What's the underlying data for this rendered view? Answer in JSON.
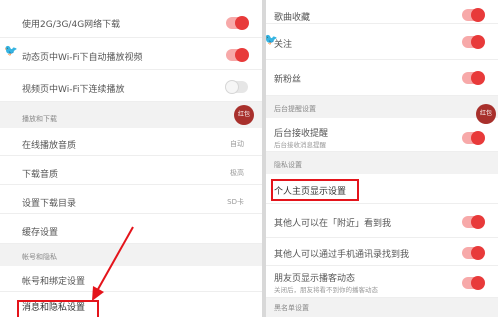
{
  "left_panel": {
    "rows": [
      {
        "label": "使用2G/3G/4G网络下载",
        "toggle": "on"
      },
      {
        "label": "动态页中Wi-Fi下自动播放视频",
        "toggle": "on"
      },
      {
        "label": "视频页中Wi-Fi下连续播放",
        "toggle": "off"
      }
    ],
    "section_playback": "播放和下载",
    "badge_text": "红包",
    "playback_rows": [
      {
        "label": "在线播放音质",
        "value": "自动"
      },
      {
        "label": "下载音质",
        "value": "极高"
      },
      {
        "label": "设置下载目录",
        "value": "SD卡"
      },
      {
        "label": "缓存设置",
        "value": ""
      }
    ],
    "section_account": "帐号和隐私",
    "account_rows": [
      {
        "label": "帐号和绑定设置"
      },
      {
        "label": "消息和隐私设置"
      }
    ]
  },
  "right_panel": {
    "rows_top": [
      {
        "label": "歌曲收藏",
        "toggle": "on"
      },
      {
        "label": "关注",
        "toggle": "on"
      },
      {
        "label": "新粉丝",
        "toggle": "on"
      }
    ],
    "section_background": "后台提醒设置",
    "badge_text": "红包",
    "background_row": {
      "label": "后台接收提醒",
      "sub": "后台接收消息提醒",
      "toggle": "on"
    },
    "section_privacy": "隐私设置",
    "privacy_rows": [
      {
        "label": "个人主页显示设置"
      },
      {
        "label": "其他人可以在「附近」看到我",
        "toggle": "on"
      },
      {
        "label": "其他人可以通过手机通讯录找到我",
        "toggle": "on"
      },
      {
        "label": "朋友页显示播客动态",
        "sub": "关闭后，朋友将看不到你的播客动态",
        "toggle": "on"
      }
    ],
    "section_blacklist": "黑名单设置"
  },
  "colors": {
    "accent": "#e83a3a",
    "highlight": "#e4141b"
  }
}
